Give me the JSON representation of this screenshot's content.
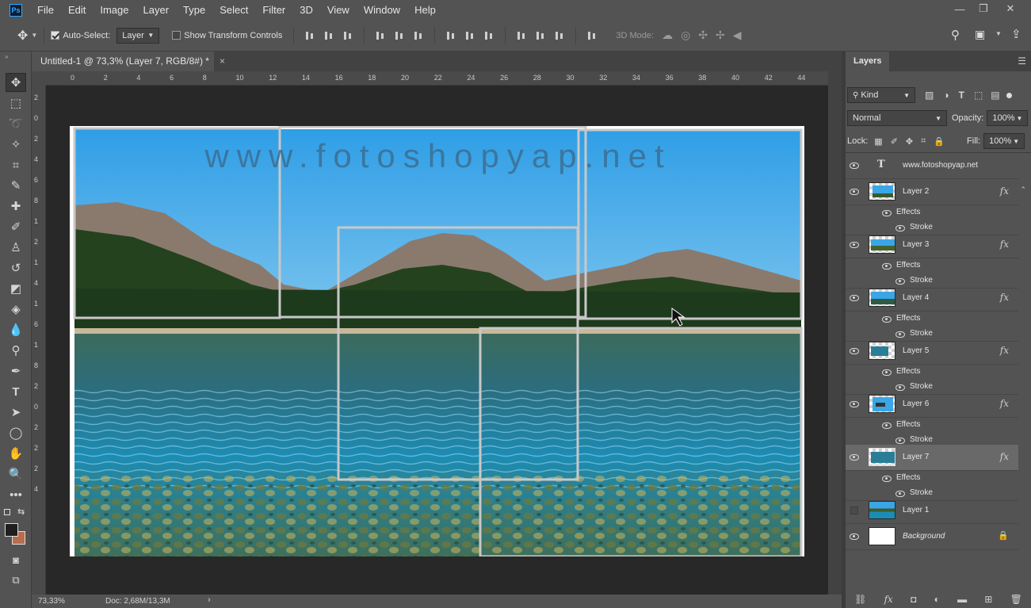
{
  "menu": [
    "File",
    "Edit",
    "Image",
    "Layer",
    "Type",
    "Select",
    "Filter",
    "3D",
    "View",
    "Window",
    "Help"
  ],
  "app_logo": "Ps",
  "options": {
    "auto_select_label": "Auto-Select:",
    "auto_select_checked": true,
    "auto_select_target": "Layer",
    "show_transform_label": "Show Transform Controls",
    "show_transform_checked": false,
    "mode3d_label": "3D Mode:"
  },
  "document_tab": {
    "title": "Untitled-1 @ 73,3% (Layer 7, RGB/8#) *",
    "close": "×"
  },
  "ruler_h_ticks": [
    "0",
    "2",
    "4",
    "6",
    "8",
    "10",
    "12",
    "14",
    "16",
    "18",
    "20",
    "22",
    "24",
    "26",
    "28",
    "30",
    "32",
    "34",
    "36",
    "38",
    "40",
    "42",
    "44"
  ],
  "ruler_v_ticks": [
    "2",
    "0",
    "2",
    "4",
    "6",
    "8",
    "1",
    "2",
    "1",
    "4",
    "1",
    "6",
    "1",
    "8",
    "2",
    "0",
    "2",
    "2",
    "2",
    "4"
  ],
  "canvas": {
    "watermark": "www.fotoshopyap.net"
  },
  "status": {
    "zoom": "73,33%",
    "doc": "Doc: 2,68M/13,3M"
  },
  "layers_panel": {
    "tab": "Layers",
    "filter_kind": "Kind",
    "blend_mode": "Normal",
    "opacity_label": "Opacity:",
    "opacity_value": "100%",
    "lock_label": "Lock:",
    "fill_label": "Fill:",
    "fill_value": "100%",
    "layers": [
      {
        "name": "www.fotoshopyap.net",
        "type": "text",
        "visible": true
      },
      {
        "name": "Layer 2",
        "visible": true,
        "fx": "fx",
        "effects_label": "Effects",
        "effect": "Stroke"
      },
      {
        "name": "Layer 3",
        "visible": true,
        "fx": "fx",
        "effects_label": "Effects",
        "effect": "Stroke"
      },
      {
        "name": "Layer 4",
        "visible": true,
        "fx": "fx",
        "effects_label": "Effects",
        "effect": "Stroke"
      },
      {
        "name": "Layer 5",
        "visible": true,
        "fx": "fx",
        "effects_label": "Effects",
        "effect": "Stroke"
      },
      {
        "name": "Layer 6",
        "visible": true,
        "fx": "fx",
        "effects_label": "Effects",
        "effect": "Stroke"
      },
      {
        "name": "Layer 7",
        "visible": true,
        "selected": true,
        "fx": "fx",
        "effects_label": "Effects",
        "effect": "Stroke"
      },
      {
        "name": "Layer 1",
        "visible": false
      },
      {
        "name": "Background",
        "visible": true,
        "locked": true
      }
    ]
  },
  "colors": {
    "accent": "#31a8ff",
    "panel": "#535353",
    "workspace": "#282828",
    "sky": "#3aa6e6",
    "water": "#1c6d86"
  }
}
